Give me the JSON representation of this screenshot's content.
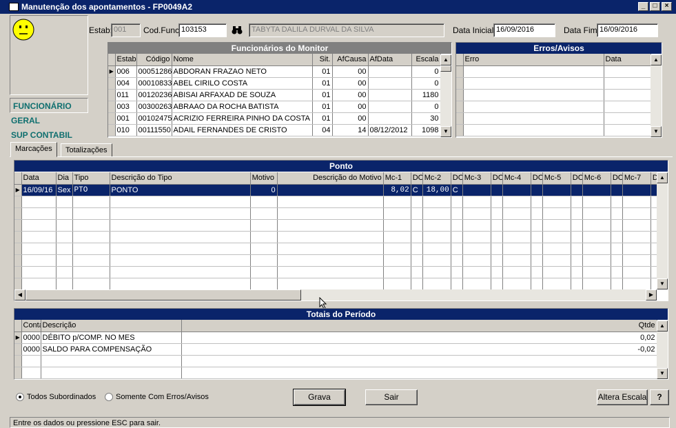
{
  "window": {
    "title": "Manutenção dos apontamentos - FP0049A2"
  },
  "nav": {
    "items": [
      "FUNCIONÁRIO",
      "GERAL",
      "SUP CONTABIL"
    ]
  },
  "filters": {
    "estab_label": "Estab:",
    "estab_value": "001",
    "codfunc_label": "Cod.Func:",
    "codfunc_value": "103153",
    "employee_name": "TABYTA DALILA DURVAL DA SILVA",
    "data_inicial_label": "Data Inicial:",
    "data_inicial_value": "16/09/2016",
    "data_fim_label": "Data Fim:",
    "data_fim_value": "16/09/2016"
  },
  "funcionarios": {
    "title": "Funcionários do Monitor",
    "columns": [
      "Estab",
      "Código",
      "Nome",
      "Sit.",
      "AfCausa",
      "AfData",
      "Escala"
    ],
    "rows": [
      [
        "006",
        "00051286",
        "ABDORAN FRAZAO NETO",
        "01",
        "00",
        "",
        "0"
      ],
      [
        "004",
        "00010833",
        "ABEL CIRILO COSTA",
        "01",
        "00",
        "",
        "0"
      ],
      [
        "011",
        "00120236",
        "ABISAI ARFAXAD DE SOUZA",
        "01",
        "00",
        "",
        "1180"
      ],
      [
        "003",
        "00300263",
        "ABRAAO DA ROCHA BATISTA",
        "01",
        "00",
        "",
        "0"
      ],
      [
        "001",
        "00102475",
        "ACRIZIO FERREIRA PINHO DA COSTA",
        "01",
        "00",
        "",
        "30"
      ],
      [
        "010",
        "00111550",
        "ADAIL FERNANDES DE CRISTO",
        "04",
        "14",
        "08/12/2012",
        "1098"
      ]
    ]
  },
  "erros": {
    "title": "Erros/Avisos",
    "columns": [
      "Erro",
      "Data"
    ]
  },
  "tabs": [
    "Marcações",
    "Totalizações"
  ],
  "ponto": {
    "title": "Ponto",
    "columns": [
      "Data",
      "Dia",
      "Tipo",
      "Descrição do Tipo",
      "Motivo",
      "Descrição do Motivo",
      "Mc-1",
      "DO",
      "Mc-2",
      "DO",
      "Mc-3",
      "DO",
      "Mc-4",
      "DO",
      "Mc-5",
      "DO",
      "Mc-6",
      "DO",
      "Mc-7",
      "D"
    ],
    "rows": [
      [
        "16/09/16",
        "Sex",
        "PTO",
        "PONTO",
        "0",
        "",
        "8,02",
        "C",
        "18,00",
        "C",
        "",
        "",
        "",
        "",
        "",
        "",
        "",
        "",
        "",
        ""
      ]
    ]
  },
  "totais": {
    "title": "Totais do Período",
    "columns": [
      "Conta",
      "Descrição",
      "Qtde"
    ],
    "rows": [
      [
        "0000",
        "DÉBITO p/COMP. NO MES",
        "0,02"
      ],
      [
        "0000",
        "SALDO PARA COMPENSAÇÃO",
        "-0,02"
      ]
    ]
  },
  "options": {
    "todos": "Todos Subordinados",
    "somente": "Somente Com Erros/Avisos"
  },
  "buttons": {
    "grava": "Grava",
    "sair": "Sair",
    "altera": "Altera Escala",
    "help": "?"
  },
  "status": {
    "text": "Entre os dados ou pressione ESC para sair."
  }
}
